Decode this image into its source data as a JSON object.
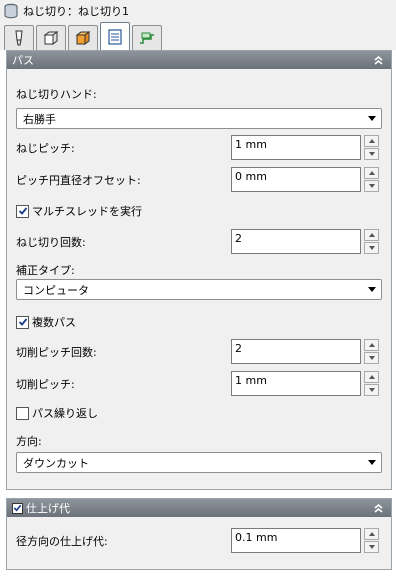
{
  "window": {
    "title": "ねじ切り：ねじ切り1",
    "icon": "database-stack-icon"
  },
  "tabs": [
    {
      "icon": "tool-icon",
      "active": false
    },
    {
      "icon": "stock-box-icon",
      "active": false
    },
    {
      "icon": "geometry-box-icon",
      "active": false
    },
    {
      "icon": "passes-list-icon",
      "active": true
    },
    {
      "icon": "linking-icon",
      "active": false
    }
  ],
  "passes_section": {
    "header": "パス",
    "thread_hand_label": "ねじ切りハンド:",
    "thread_hand_value": "右勝手",
    "thread_pitch_label": "ねじピッチ:",
    "thread_pitch_value": "1 mm",
    "pitch_offset_label": "ピッチ円直径オフセット:",
    "pitch_offset_value": "0 mm",
    "multi_thread_label": "マルチスレッドを実行",
    "multi_thread_checked": true,
    "thread_count_label": "ねじ切り回数:",
    "thread_count_value": "2",
    "compensation_label": "補正タイプ:",
    "compensation_value": "コンピュータ",
    "multiple_passes_label": "複数パス",
    "multiple_passes_checked": true,
    "cut_pitch_count_label": "切削ピッチ回数:",
    "cut_pitch_count_value": "2",
    "cut_pitch_label": "切削ピッチ:",
    "cut_pitch_value": "1 mm",
    "repeat_pass_label": "パス繰り返し",
    "repeat_pass_checked": false,
    "direction_label": "方向:",
    "direction_value": "ダウンカット"
  },
  "stock_section": {
    "header": "仕上げ代",
    "header_checked": true,
    "radial_label": "径方向の仕上げ代:",
    "radial_value": "0.1 mm"
  },
  "colors": {
    "section_header": "#7a8088",
    "panel_bg": "#f0f0f0"
  }
}
